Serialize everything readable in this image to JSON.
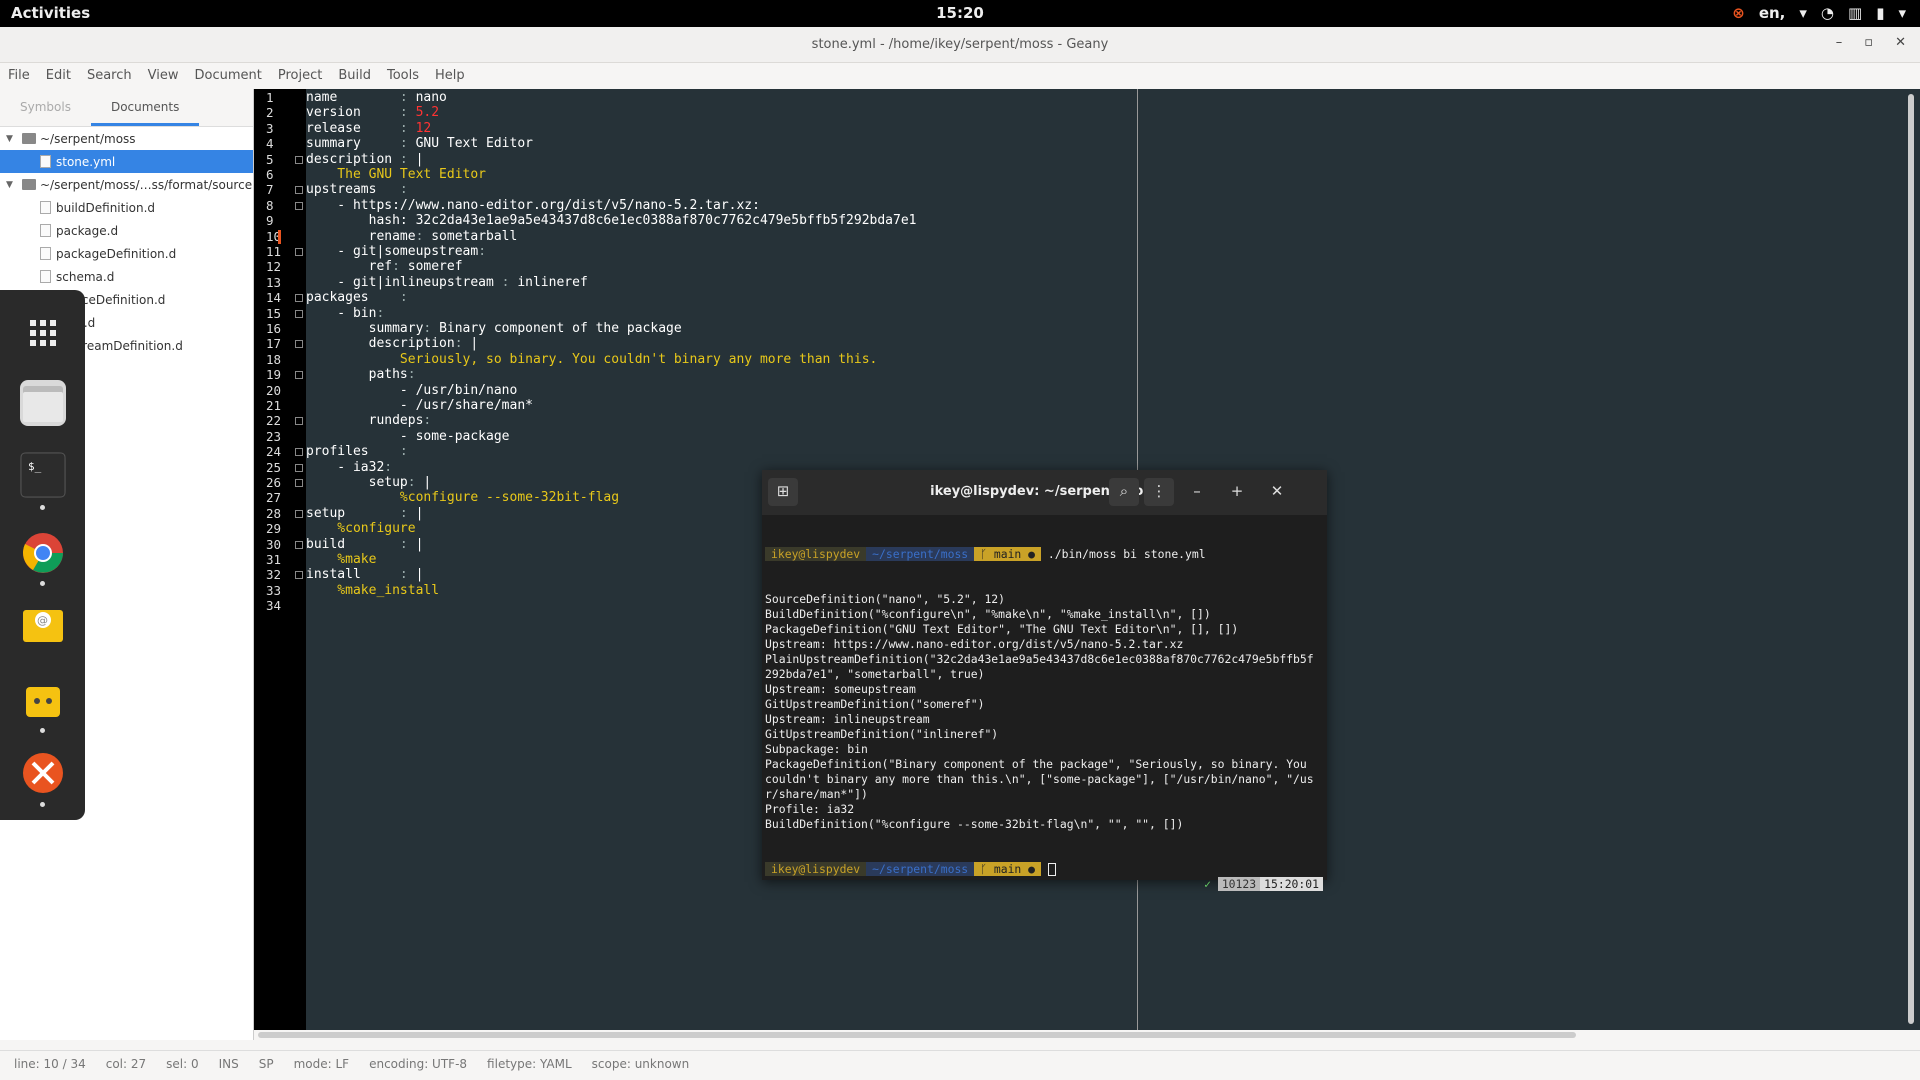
{
  "topbar": {
    "activities": "Activities",
    "clock": "15:20",
    "language": "en,"
  },
  "window": {
    "title": "stone.yml - /home/ikey/serpent/moss - Geany"
  },
  "menu": [
    "File",
    "Edit",
    "Search",
    "View",
    "Document",
    "Project",
    "Build",
    "Tools",
    "Help"
  ],
  "sidebar": {
    "tabs": [
      "Symbols",
      "Documents"
    ],
    "tree": [
      {
        "label": "~/serpent/moss",
        "type": "folder"
      },
      {
        "label": "stone.yml",
        "type": "file",
        "selected": true
      },
      {
        "label": "~/serpent/moss/…ss/format/source",
        "type": "folder"
      },
      {
        "label": "buildDefinition.d",
        "type": "file"
      },
      {
        "label": "package.d",
        "type": "file"
      },
      {
        "label": "packageDefinition.d",
        "type": "file"
      },
      {
        "label": "schema.d",
        "type": "file"
      },
      {
        "label": "sourceDefinition.d",
        "type": "file"
      },
      {
        "label": "spec.d",
        "type": "file"
      },
      {
        "label": "upstreamDefinition.d",
        "type": "file"
      }
    ]
  },
  "dock": [
    "show-apps",
    "files",
    "terminal",
    "chrome",
    "mail",
    "store",
    "software"
  ],
  "editor": {
    "lines": [
      [
        [
          "k",
          "name        "
        ],
        [
          "p",
          ": "
        ],
        [
          "k",
          "nano"
        ]
      ],
      [
        [
          "k",
          "version     "
        ],
        [
          "p",
          ": "
        ],
        [
          "n",
          "5.2"
        ]
      ],
      [
        [
          "k",
          "release     "
        ],
        [
          "p",
          ": "
        ],
        [
          "n",
          "12"
        ]
      ],
      [
        [
          "k",
          "summary     "
        ],
        [
          "p",
          ": "
        ],
        [
          "k",
          "GNU Text Editor"
        ]
      ],
      [
        [
          "k",
          "description "
        ],
        [
          "p",
          ": "
        ],
        [
          "k",
          "|"
        ]
      ],
      [
        [
          "s",
          "    The GNU Text Editor"
        ]
      ],
      [
        [
          "k",
          "upstreams   "
        ],
        [
          "p",
          ":"
        ]
      ],
      [
        [
          "k",
          "    - https://www.nano-editor.org/dist/v5/nano-5.2.tar.xz:"
        ]
      ],
      [
        [
          "k",
          "        hash: 32c2da43e1ae9a5e43437d8c6e1ec0388af870c7762c479e5bffb5f292bda7e1"
        ]
      ],
      [
        [
          "k",
          "        rename"
        ],
        [
          "p",
          ": "
        ],
        [
          "k",
          "sometarball"
        ]
      ],
      [
        [
          "k",
          "    - git|someupstream"
        ],
        [
          "p",
          ":"
        ]
      ],
      [
        [
          "k",
          "        ref"
        ],
        [
          "p",
          ": "
        ],
        [
          "k",
          "someref"
        ]
      ],
      [
        [
          "k",
          "    - git|inlineupstream "
        ],
        [
          "p",
          ": "
        ],
        [
          "k",
          "inlineref"
        ]
      ],
      [
        [
          "k",
          "packages    "
        ],
        [
          "p",
          ":"
        ]
      ],
      [
        [
          "k",
          "    - bin"
        ],
        [
          "p",
          ":"
        ]
      ],
      [
        [
          "k",
          "        summary"
        ],
        [
          "p",
          ": "
        ],
        [
          "k",
          "Binary component of the package"
        ]
      ],
      [
        [
          "k",
          "        description"
        ],
        [
          "p",
          ": "
        ],
        [
          "k",
          "|"
        ]
      ],
      [
        [
          "s",
          "            Seriously, so binary. You couldn't binary any more than this."
        ]
      ],
      [
        [
          "k",
          "        paths"
        ],
        [
          "p",
          ":"
        ]
      ],
      [
        [
          "k",
          "            - /usr/bin/nano"
        ]
      ],
      [
        [
          "k",
          "            - /usr/share/man*"
        ]
      ],
      [
        [
          "k",
          "        rundeps"
        ],
        [
          "p",
          ":"
        ]
      ],
      [
        [
          "k",
          "            - some-package"
        ]
      ],
      [
        [
          "k",
          "profiles    "
        ],
        [
          "p",
          ":"
        ]
      ],
      [
        [
          "k",
          "    - ia32"
        ],
        [
          "p",
          ":"
        ]
      ],
      [
        [
          "k",
          "        setup"
        ],
        [
          "p",
          ": "
        ],
        [
          "k",
          "|"
        ]
      ],
      [
        [
          "s",
          "            %configure --some-32bit-flag"
        ]
      ],
      [
        [
          "k",
          "setup       "
        ],
        [
          "p",
          ": "
        ],
        [
          "k",
          "|"
        ]
      ],
      [
        [
          "s",
          "    %configure"
        ]
      ],
      [
        [
          "k",
          "build       "
        ],
        [
          "p",
          ": "
        ],
        [
          "k",
          "|"
        ]
      ],
      [
        [
          "s",
          "    %make"
        ]
      ],
      [
        [
          "k",
          "install     "
        ],
        [
          "p",
          ": "
        ],
        [
          "k",
          "|"
        ]
      ],
      [
        [
          "s",
          "    %make_install"
        ]
      ],
      [
        [
          "k",
          ""
        ]
      ]
    ],
    "folds": [
      5,
      7,
      8,
      11,
      14,
      15,
      17,
      19,
      22,
      24,
      25,
      26,
      28,
      30,
      32
    ],
    "modified_line": 10
  },
  "terminal": {
    "title": "ikey@lispydev: ~/serpent/moss",
    "prompt_user": "ikey@lispydev",
    "prompt_path": "~/serpent/moss",
    "prompt_git": "ᚴ main ●",
    "command": "./bin/moss bi stone.yml",
    "output": [
      "SourceDefinition(\"nano\", \"5.2\", 12)",
      "BuildDefinition(\"%configure\\n\", \"%make\\n\", \"%make_install\\n\", [])",
      "PackageDefinition(\"GNU Text Editor\", \"The GNU Text Editor\\n\", [], [])",
      "Upstream: https://www.nano-editor.org/dist/v5/nano-5.2.tar.xz",
      "PlainUpstreamDefinition(\"32c2da43e1ae9a5e43437d8c6e1ec0388af870c7762c479e5bffb5f",
      "292bda7e1\", \"sometarball\", true)",
      "Upstream: someupstream",
      "GitUpstreamDefinition(\"someref\")",
      "Upstream: inlineupstream",
      "GitUpstreamDefinition(\"inlineref\")",
      "Subpackage: bin",
      "PackageDefinition(\"Binary component of the package\", \"Seriously, so binary. You",
      "couldn't binary any more than this.\\n\", [\"some-package\"], [\"/usr/bin/nano\", \"/us",
      "r/share/man*\"])",
      "Profile: ia32",
      "BuildDefinition(\"%configure --some-32bit-flag\\n\", \"\", \"\", [])"
    ],
    "status_ok": "✓",
    "status_num": "10123",
    "status_time": "15:20:01"
  },
  "status": {
    "line": "line: 10 / 34",
    "col": "col: 27",
    "sel": "sel: 0",
    "ins": "INS",
    "sp": "SP",
    "mode": "mode: LF",
    "encoding": "encoding: UTF-8",
    "filetype": "filetype: YAML",
    "scope": "scope: unknown"
  }
}
